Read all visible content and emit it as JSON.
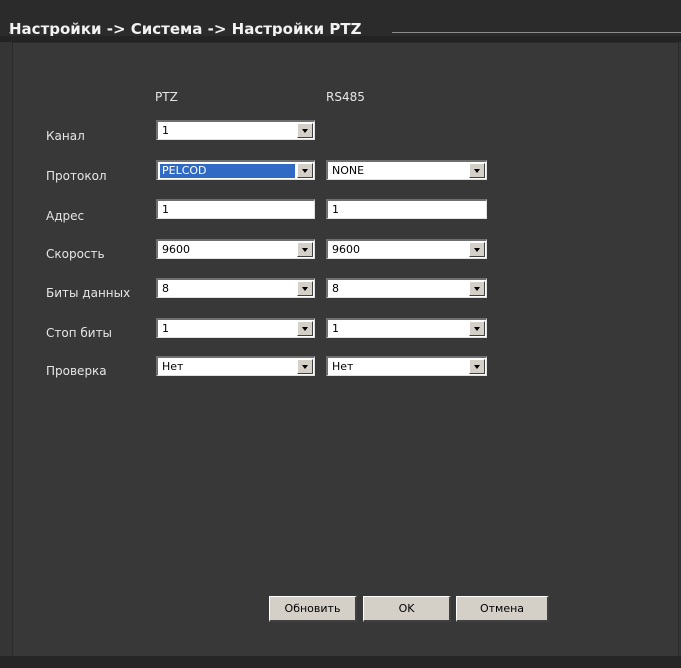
{
  "window": {
    "breadcrumb": "Настройки -> Система -> Настройки PTZ"
  },
  "columns": {
    "ptz": "PTZ",
    "rs485": "RS485"
  },
  "rows": {
    "channel": {
      "label": "Канал",
      "ptz": "1"
    },
    "protocol": {
      "label": "Протокол",
      "ptz": "PELCOD",
      "rs485": "NONE"
    },
    "address": {
      "label": "Адрес",
      "ptz": "1",
      "rs485": "1"
    },
    "speed": {
      "label": "Скорость",
      "ptz": "9600",
      "rs485": "9600"
    },
    "data_bits": {
      "label": "Биты данных",
      "ptz": "8",
      "rs485": "8"
    },
    "stop_bits": {
      "label": "Стоп биты",
      "ptz": "1",
      "rs485": "1"
    },
    "parity": {
      "label": "Проверка",
      "ptz": "Нет",
      "rs485": "Нет"
    }
  },
  "buttons": {
    "refresh": "Обновить",
    "ok": "OK",
    "cancel": "Отмена"
  },
  "colors": {
    "background": "#353535",
    "selection": "#316ac5",
    "button_face": "#d4d0c8"
  }
}
